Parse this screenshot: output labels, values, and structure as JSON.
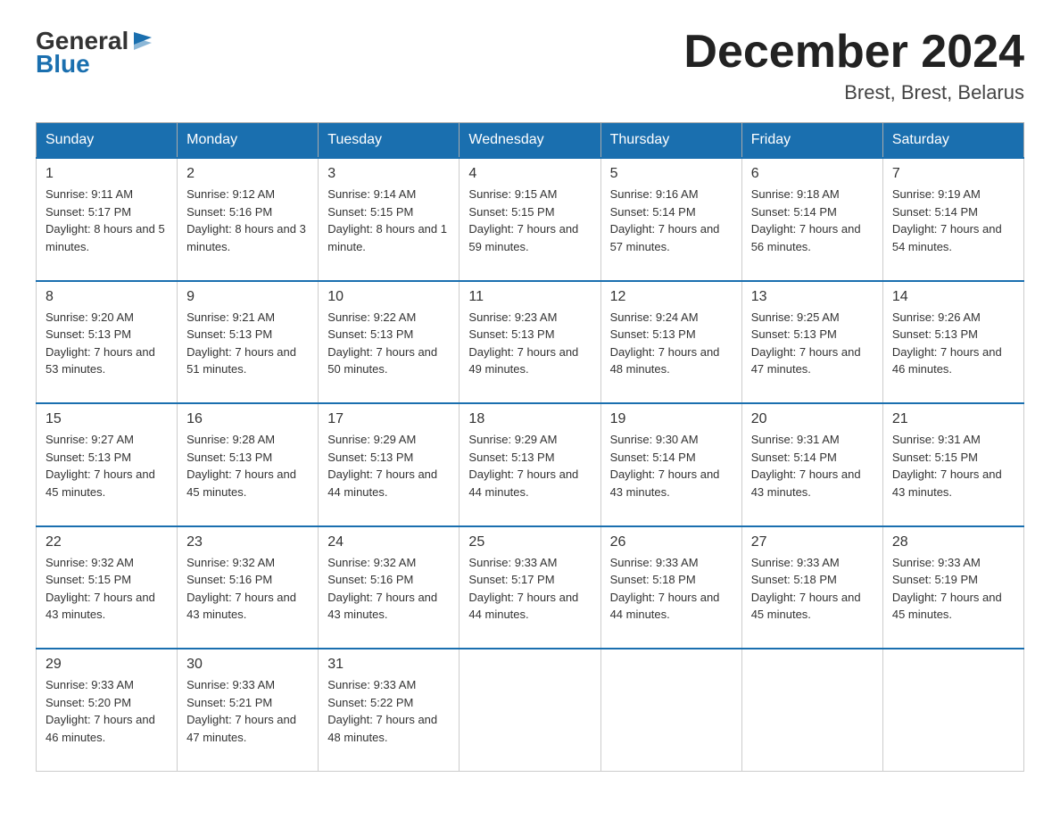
{
  "logo": {
    "general": "General",
    "blue": "Blue"
  },
  "title": "December 2024",
  "subtitle": "Brest, Brest, Belarus",
  "days_header": [
    "Sunday",
    "Monday",
    "Tuesday",
    "Wednesday",
    "Thursday",
    "Friday",
    "Saturday"
  ],
  "weeks": [
    [
      {
        "day": "1",
        "sunrise": "9:11 AM",
        "sunset": "5:17 PM",
        "daylight": "8 hours and 5 minutes."
      },
      {
        "day": "2",
        "sunrise": "9:12 AM",
        "sunset": "5:16 PM",
        "daylight": "8 hours and 3 minutes."
      },
      {
        "day": "3",
        "sunrise": "9:14 AM",
        "sunset": "5:15 PM",
        "daylight": "8 hours and 1 minute."
      },
      {
        "day": "4",
        "sunrise": "9:15 AM",
        "sunset": "5:15 PM",
        "daylight": "7 hours and 59 minutes."
      },
      {
        "day": "5",
        "sunrise": "9:16 AM",
        "sunset": "5:14 PM",
        "daylight": "7 hours and 57 minutes."
      },
      {
        "day": "6",
        "sunrise": "9:18 AM",
        "sunset": "5:14 PM",
        "daylight": "7 hours and 56 minutes."
      },
      {
        "day": "7",
        "sunrise": "9:19 AM",
        "sunset": "5:14 PM",
        "daylight": "7 hours and 54 minutes."
      }
    ],
    [
      {
        "day": "8",
        "sunrise": "9:20 AM",
        "sunset": "5:13 PM",
        "daylight": "7 hours and 53 minutes."
      },
      {
        "day": "9",
        "sunrise": "9:21 AM",
        "sunset": "5:13 PM",
        "daylight": "7 hours and 51 minutes."
      },
      {
        "day": "10",
        "sunrise": "9:22 AM",
        "sunset": "5:13 PM",
        "daylight": "7 hours and 50 minutes."
      },
      {
        "day": "11",
        "sunrise": "9:23 AM",
        "sunset": "5:13 PM",
        "daylight": "7 hours and 49 minutes."
      },
      {
        "day": "12",
        "sunrise": "9:24 AM",
        "sunset": "5:13 PM",
        "daylight": "7 hours and 48 minutes."
      },
      {
        "day": "13",
        "sunrise": "9:25 AM",
        "sunset": "5:13 PM",
        "daylight": "7 hours and 47 minutes."
      },
      {
        "day": "14",
        "sunrise": "9:26 AM",
        "sunset": "5:13 PM",
        "daylight": "7 hours and 46 minutes."
      }
    ],
    [
      {
        "day": "15",
        "sunrise": "9:27 AM",
        "sunset": "5:13 PM",
        "daylight": "7 hours and 45 minutes."
      },
      {
        "day": "16",
        "sunrise": "9:28 AM",
        "sunset": "5:13 PM",
        "daylight": "7 hours and 45 minutes."
      },
      {
        "day": "17",
        "sunrise": "9:29 AM",
        "sunset": "5:13 PM",
        "daylight": "7 hours and 44 minutes."
      },
      {
        "day": "18",
        "sunrise": "9:29 AM",
        "sunset": "5:13 PM",
        "daylight": "7 hours and 44 minutes."
      },
      {
        "day": "19",
        "sunrise": "9:30 AM",
        "sunset": "5:14 PM",
        "daylight": "7 hours and 43 minutes."
      },
      {
        "day": "20",
        "sunrise": "9:31 AM",
        "sunset": "5:14 PM",
        "daylight": "7 hours and 43 minutes."
      },
      {
        "day": "21",
        "sunrise": "9:31 AM",
        "sunset": "5:15 PM",
        "daylight": "7 hours and 43 minutes."
      }
    ],
    [
      {
        "day": "22",
        "sunrise": "9:32 AM",
        "sunset": "5:15 PM",
        "daylight": "7 hours and 43 minutes."
      },
      {
        "day": "23",
        "sunrise": "9:32 AM",
        "sunset": "5:16 PM",
        "daylight": "7 hours and 43 minutes."
      },
      {
        "day": "24",
        "sunrise": "9:32 AM",
        "sunset": "5:16 PM",
        "daylight": "7 hours and 43 minutes."
      },
      {
        "day": "25",
        "sunrise": "9:33 AM",
        "sunset": "5:17 PM",
        "daylight": "7 hours and 44 minutes."
      },
      {
        "day": "26",
        "sunrise": "9:33 AM",
        "sunset": "5:18 PM",
        "daylight": "7 hours and 44 minutes."
      },
      {
        "day": "27",
        "sunrise": "9:33 AM",
        "sunset": "5:18 PM",
        "daylight": "7 hours and 45 minutes."
      },
      {
        "day": "28",
        "sunrise": "9:33 AM",
        "sunset": "5:19 PM",
        "daylight": "7 hours and 45 minutes."
      }
    ],
    [
      {
        "day": "29",
        "sunrise": "9:33 AM",
        "sunset": "5:20 PM",
        "daylight": "7 hours and 46 minutes."
      },
      {
        "day": "30",
        "sunrise": "9:33 AM",
        "sunset": "5:21 PM",
        "daylight": "7 hours and 47 minutes."
      },
      {
        "day": "31",
        "sunrise": "9:33 AM",
        "sunset": "5:22 PM",
        "daylight": "7 hours and 48 minutes."
      },
      null,
      null,
      null,
      null
    ]
  ]
}
